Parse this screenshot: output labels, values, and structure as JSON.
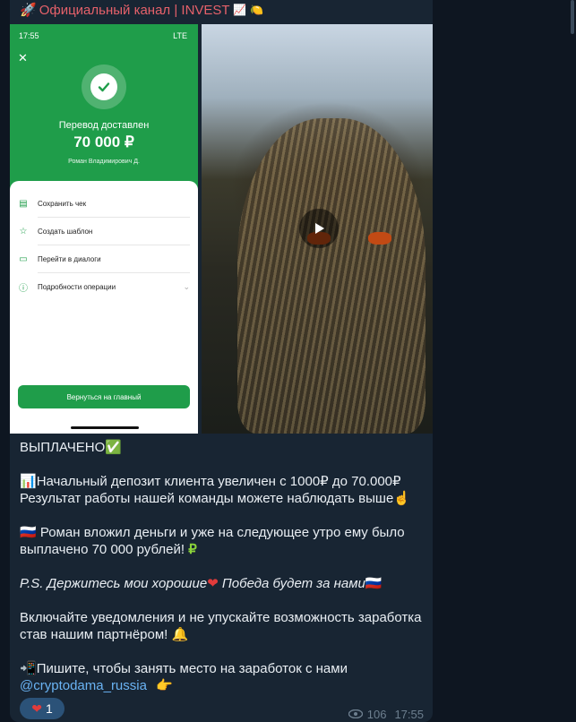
{
  "channel": {
    "name": "Официальный канал | INVEST",
    "prefix_emoji": "🚀",
    "suffix_emoji_1": "📈",
    "suffix_emoji_2": "🍋"
  },
  "phone": {
    "time": "17:55",
    "network": "LTE",
    "close": "✕",
    "title": "Перевод доставлен",
    "amount": "70 000 ₽",
    "recipient": "Роман Владимирович Д.",
    "menu": [
      {
        "label": "Сохранить чек",
        "icon": "receipt-icon"
      },
      {
        "label": "Создать шаблон",
        "icon": "star-icon"
      },
      {
        "label": "Перейти в диалоги",
        "icon": "chat-icon"
      },
      {
        "label": "Подробности операции",
        "icon": "info-icon"
      }
    ],
    "button": "Вернуться на главный"
  },
  "video": {
    "play_icon": "play-icon"
  },
  "caption": {
    "l1": "ВЫПЛАЧЕНО",
    "l1_emoji": "✅",
    "l2_emoji": "📊",
    "l2": "Начальный депозит клиента увеличен с 1000₽ до 70.000₽",
    "l3": "Результат работы нашей команды можете наблюдать выше",
    "l3_emoji": "☝",
    "l4_emoji": "🇷🇺",
    "l4": " Роман вложил деньги и уже на следующее утро ему было",
    "l5": "выплачено 70 000 рублей!",
    "l5_emoji": "₽",
    "l6a": "P.S. Держитесь мои хорошие",
    "l6_emoji": "❤",
    "l6b": " Победа будет за нами",
    "l6_flag": "🇷🇺",
    "l7": "Включайте уведомления и не упускайте возможность заработка",
    "l8": "став нашим партнёром!",
    "l8_emoji": "🔔",
    "l9_emoji": "📲",
    "l9": "Пишите, чтобы занять место на заработок с нами",
    "l10_link": "@cryptodama_russia",
    "l10_emoji": "👉"
  },
  "reaction": {
    "emoji": "❤",
    "count": "1"
  },
  "meta": {
    "views": "106",
    "time": "17:55"
  },
  "colors": {
    "bubble": "#182533",
    "background": "#0e1621",
    "channel_name": "#e5616a",
    "link": "#6ab3f3",
    "green": "#1f9d4a"
  }
}
